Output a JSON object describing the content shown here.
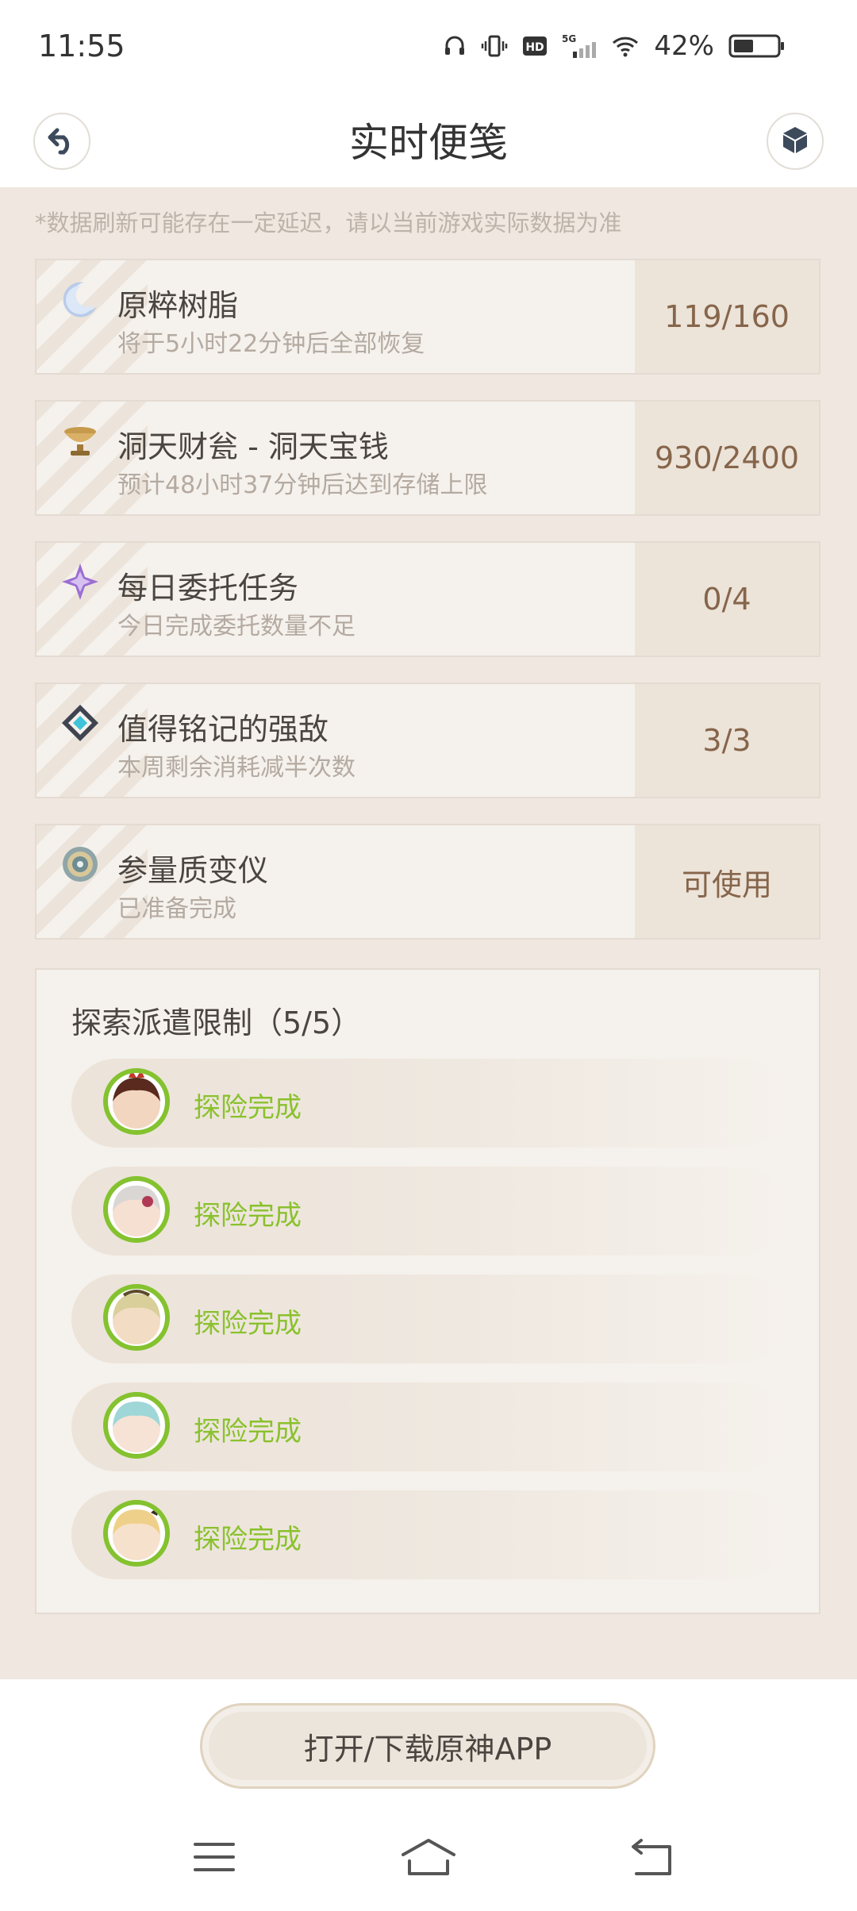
{
  "status_bar": {
    "time": "11:55",
    "battery": "42%",
    "icons": [
      "headphones-icon",
      "vibrate-icon",
      "hd-icon",
      "signal-5g-icon",
      "wifi-icon",
      "battery-icon"
    ]
  },
  "header": {
    "title": "实时便笺",
    "back_icon": "back-arrow-icon",
    "right_icon": "cube-icon"
  },
  "notice": "*数据刷新可能存在一定延迟，请以当前游戏实际数据为准",
  "resources": [
    {
      "icon": "resin-moon-icon",
      "title": "原粹树脂",
      "subtitle": "将于5小时22分钟后全部恢复",
      "value": "119/160"
    },
    {
      "icon": "teapot-bowl-icon",
      "title": "洞天财瓮 - 洞天宝钱",
      "subtitle": "预计48小时37分钟后达到存储上限",
      "value": "930/2400"
    },
    {
      "icon": "daily-commission-icon",
      "title": "每日委托任务",
      "subtitle": "今日完成委托数量不足",
      "value": "0/4"
    },
    {
      "icon": "weekly-boss-icon",
      "title": "值得铭记的强敌",
      "subtitle": "本周剩余消耗减半次数",
      "value": "3/3"
    },
    {
      "icon": "transformer-icon",
      "title": "参量质变仪",
      "subtitle": "已准备完成",
      "value": "可使用"
    }
  ],
  "expedition": {
    "title": "探索派遣限制（5/5）",
    "items": [
      {
        "status": "探险完成"
      },
      {
        "status": "探险完成"
      },
      {
        "status": "探险完成"
      },
      {
        "status": "探险完成"
      },
      {
        "status": "探险完成"
      }
    ]
  },
  "bottom": {
    "button_label": "打开/下载原神APP",
    "nav": [
      "menu-icon",
      "home-icon",
      "back-icon"
    ]
  },
  "colors": {
    "background": "#efe7e0",
    "value_text": "#86654a",
    "status_green": "#8ac12d",
    "avatar_ring": "#84c22f"
  }
}
